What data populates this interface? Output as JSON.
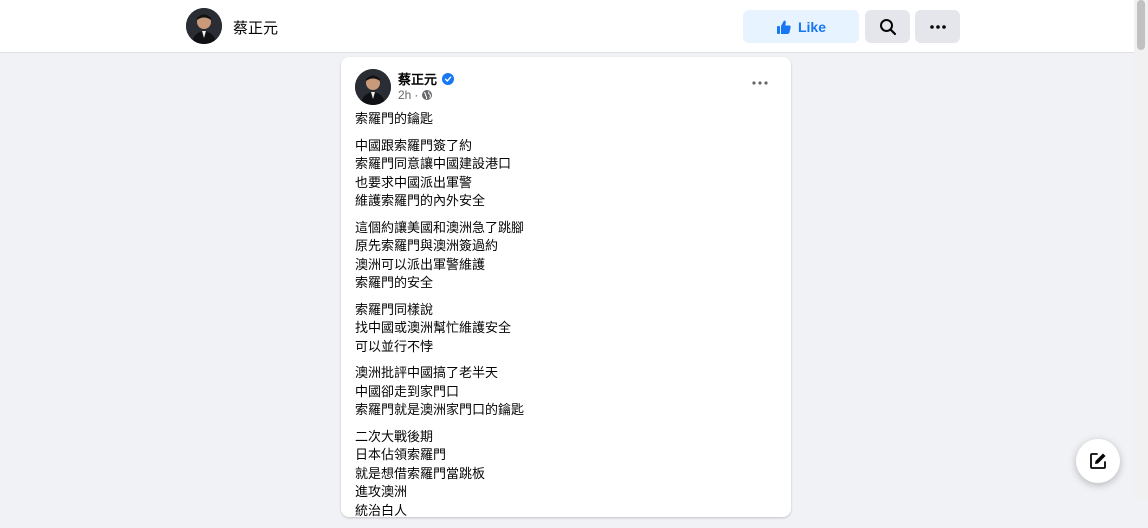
{
  "header": {
    "name": "蔡正元",
    "like_label": "Like",
    "like_icon": "thumbs-up-icon",
    "search_icon": "search-icon",
    "more_icon": "more-horizontal-icon"
  },
  "post": {
    "author": "蔡正元",
    "verified_icon": "verified-badge-icon",
    "time": "2h",
    "separator": "·",
    "audience_icon": "globe-icon",
    "more_icon": "more-horizontal-icon",
    "paragraphs": [
      [
        "索羅門的鑰匙"
      ],
      [
        "中國跟索羅門簽了約",
        "索羅門同意讓中國建設港口",
        "也要求中國派出軍警",
        "維護索羅門的內外安全"
      ],
      [
        "這個約讓美國和澳洲急了跳腳",
        "原先索羅門與澳洲簽過約",
        "澳洲可以派出軍警維護",
        "索羅門的安全"
      ],
      [
        "索羅門同樣說",
        "找中國或澳洲幫忙維護安全",
        "可以並行不悖"
      ],
      [
        "澳洲批評中國搞了老半天",
        "中國卻走到家門口",
        "索羅門就是澳洲家門口的鑰匙"
      ],
      [
        "二次大戰後期",
        "日本佔領索羅門",
        "就是想借索羅門當跳板",
        "進攻澳洲",
        "統治白人"
      ]
    ]
  },
  "fab": {
    "icon": "compose-message-icon"
  },
  "colors": {
    "accent": "#1877f2",
    "background": "#f0f2f5",
    "like_bg": "#e7f3ff"
  }
}
